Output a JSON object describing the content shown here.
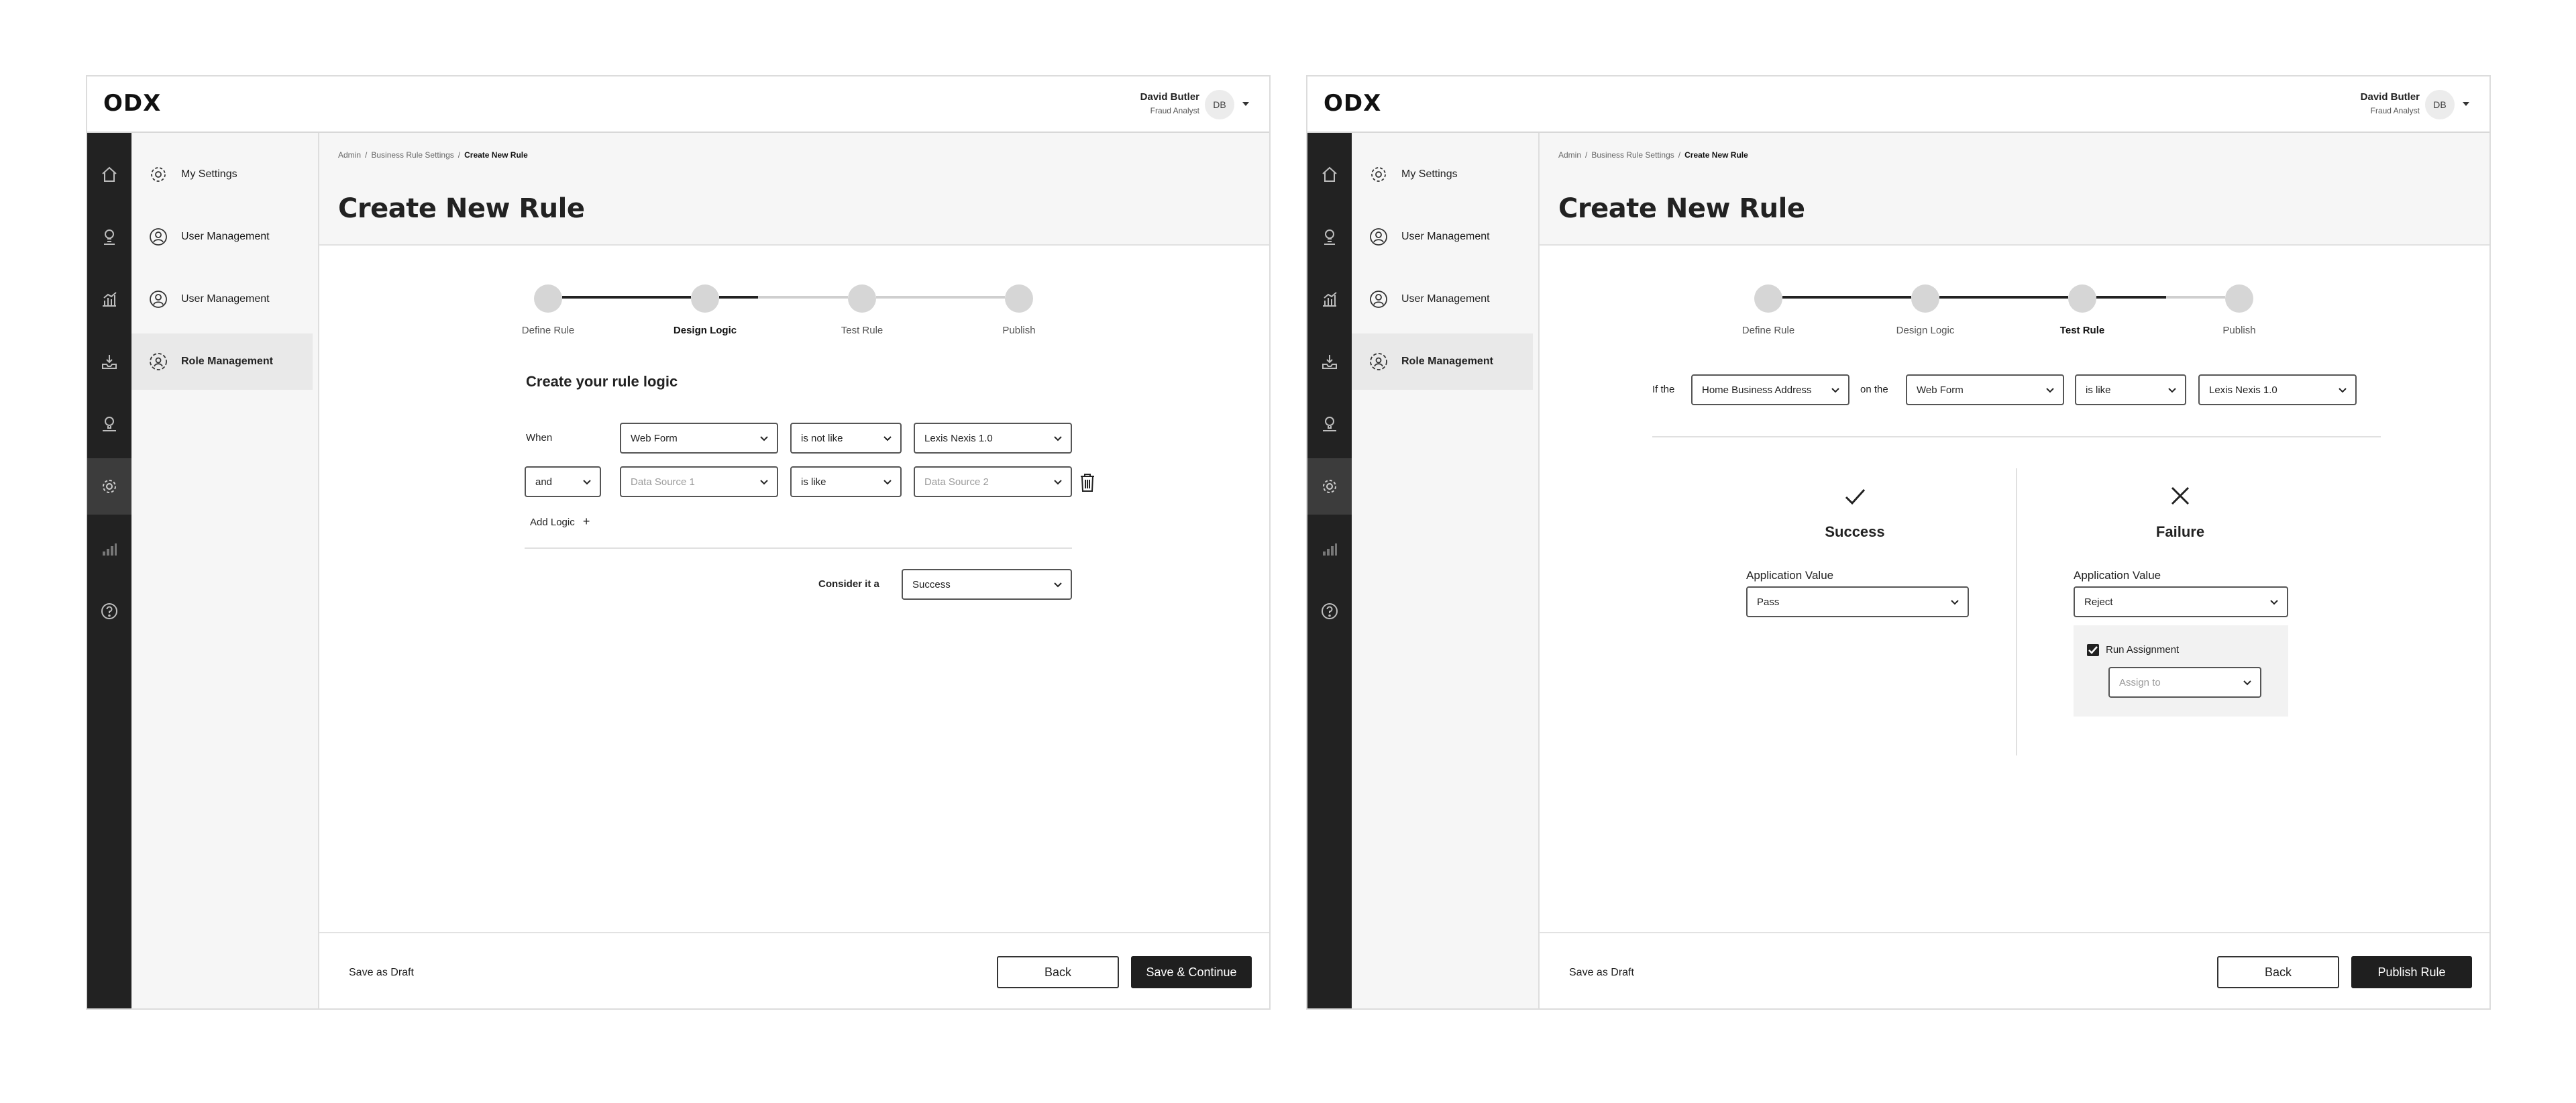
{
  "app": {
    "logo": "ODX"
  },
  "user": {
    "name": "David Butler",
    "role": "Fraud Analyst",
    "initials": "DB"
  },
  "sidebar": {
    "rail_icons": [
      "home-icon",
      "lightbulb-icon",
      "chart-icon",
      "inbox-icon",
      "bulb-hand-icon",
      "gear-icon",
      "bar-chart-icon",
      "help-icon"
    ],
    "active_rail": "gear-icon",
    "items": [
      {
        "label": "My Settings",
        "icon": "gear-icon"
      },
      {
        "label": "User Management",
        "icon": "user-icon"
      },
      {
        "label": "User Management",
        "icon": "user-icon"
      },
      {
        "label": "Role Management",
        "icon": "role-icon",
        "active": true
      }
    ]
  },
  "breadcrumb": {
    "admin": "Admin",
    "settings": "Business Rule Settings",
    "current": "Create New Rule"
  },
  "page_title": "Create New Rule",
  "steps": [
    "Define Rule",
    "Design Logic",
    "Test Rule",
    "Publish"
  ],
  "screen1": {
    "active_step": "Design Logic",
    "section_title": "Create your rule logic",
    "when_label": "When",
    "row1": {
      "field": "Web Form",
      "operator": "is not like",
      "value": "Lexis Nexis 1.0"
    },
    "row2": {
      "connector": "and",
      "field_placeholder": "Data Source 1",
      "operator": "is like",
      "value_placeholder": "Data Source 2"
    },
    "add_logic": "Add Logic",
    "consider_label": "Consider it a",
    "consider_value": "Success",
    "footer": {
      "draft": "Save as Draft",
      "back": "Back",
      "primary": "Save & Continue"
    }
  },
  "screen2": {
    "active_step": "Test Rule",
    "if_the": "If the",
    "field": "Home Business Address",
    "on_the": "on the",
    "source": "Web Form",
    "operator": "is like",
    "value": "Lexis Nexis 1.0",
    "success": {
      "title": "Success",
      "label": "Application Value",
      "value": "Pass"
    },
    "failure": {
      "title": "Failure",
      "label": "Application Value",
      "value": "Reject",
      "run_assignment": "Run Assignment",
      "assign_placeholder": "Assign to"
    },
    "footer": {
      "draft": "Save as Draft",
      "back": "Back",
      "primary": "Publish Rule"
    }
  },
  "colors": {
    "rail": "#222222",
    "primary_button": "#1f1f1f",
    "step_dot": "#d6d6d6",
    "step_line_done": "#222222",
    "step_line_todo": "#cfcfcf"
  }
}
